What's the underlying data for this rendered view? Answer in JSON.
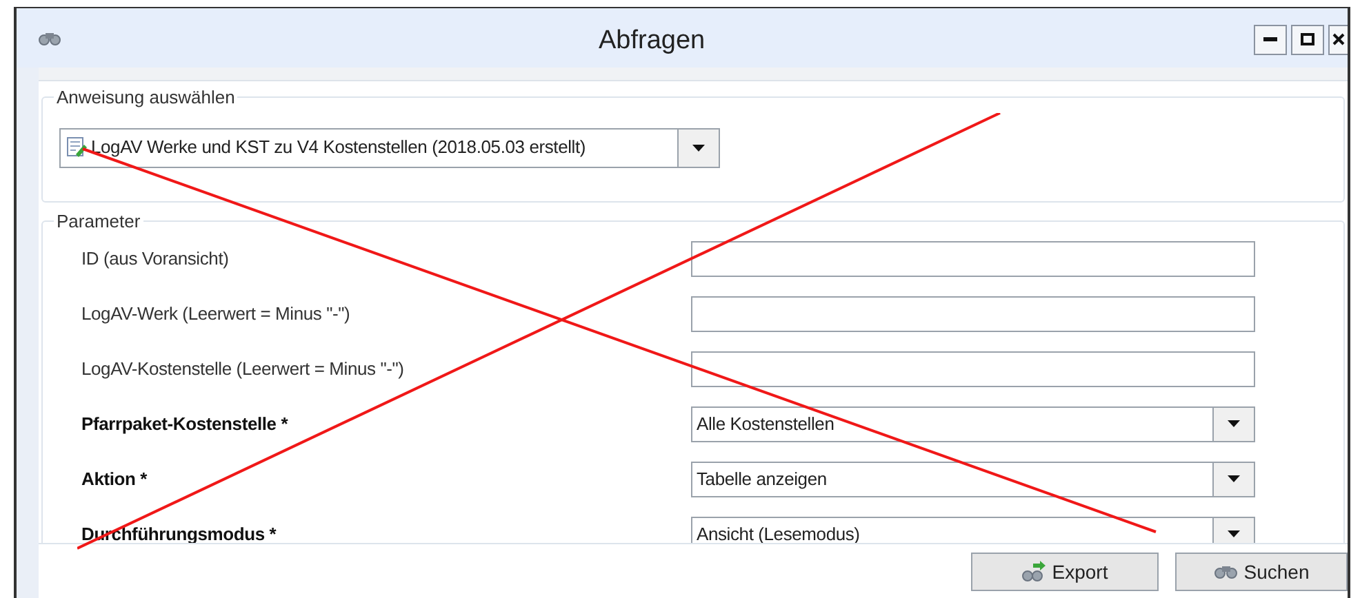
{
  "window": {
    "title": "Abfragen"
  },
  "statement": {
    "legend": "Anweisung auswählen",
    "selection": "LogAV Werke und KST zu V4 Kostenstellen (2018.05.03 erstellt)"
  },
  "parameters": {
    "legend": "Parameter",
    "rows": [
      {
        "kind": "text",
        "label": "ID (aus Voransicht)",
        "required": false
      },
      {
        "kind": "text",
        "label": "LogAV-Werk (Leerwert = Minus \"-\")",
        "required": false
      },
      {
        "kind": "text",
        "label": "LogAV-Kostenstelle (Leerwert = Minus \"-\")",
        "required": false
      },
      {
        "kind": "dropdown",
        "label": "Pfarrpaket-Kostenstelle *",
        "required": true,
        "value": "Alle Kostenstellen"
      },
      {
        "kind": "dropdown",
        "label": "Aktion *",
        "required": true,
        "value": "Tabelle anzeigen"
      },
      {
        "kind": "dropdown",
        "label": "Durchführungsmodus *",
        "required": true,
        "value": "Ansicht (Lesemodus)"
      }
    ]
  },
  "buttons": [
    {
      "kind": "export",
      "label": "Export"
    },
    {
      "kind": "search",
      "label": "Suchen"
    }
  ],
  "crossed_out": true
}
